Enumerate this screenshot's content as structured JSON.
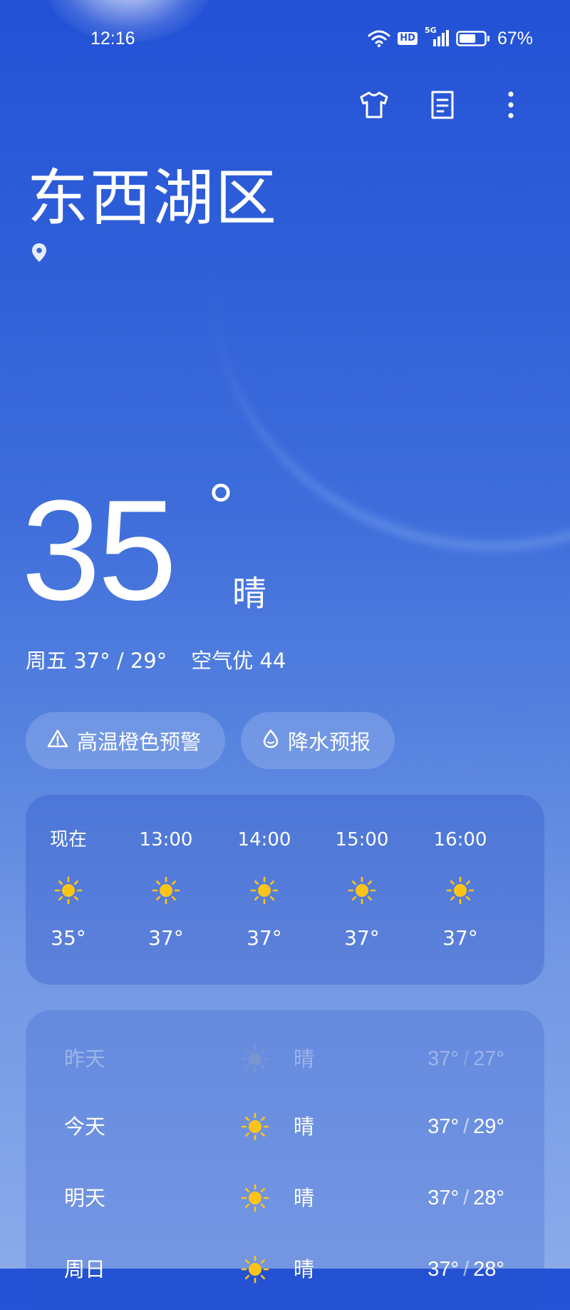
{
  "status_bar": {
    "time": "12:16",
    "network": "5G",
    "hd": "HD",
    "battery": "67%",
    "battery_level": 0.67,
    "icons": [
      "wifi-icon",
      "hd-icon",
      "signal-5g-icon",
      "battery-icon"
    ]
  },
  "top_actions": {
    "icons": [
      "tshirt-icon",
      "document-icon",
      "more-vertical-icon"
    ]
  },
  "location": {
    "city": "东西湖区",
    "pin_icon": "location-pin-icon"
  },
  "current": {
    "temperature": "35",
    "degree": "°",
    "condition": "晴",
    "summary": "周五 37° / 29°",
    "air_quality": "空气优 44"
  },
  "chips": [
    {
      "label": "高温橙色预警",
      "icon": "warning-triangle-icon"
    },
    {
      "label": "降水预报",
      "icon": "raindrop-icon"
    }
  ],
  "hourly": [
    {
      "time": "现在",
      "temp": "35°",
      "icon": "sun-icon"
    },
    {
      "time": "13:00",
      "temp": "37°",
      "icon": "sun-icon"
    },
    {
      "time": "14:00",
      "temp": "37°",
      "icon": "sun-icon"
    },
    {
      "time": "15:00",
      "temp": "37°",
      "icon": "sun-icon"
    },
    {
      "time": "16:00",
      "temp": "37°",
      "icon": "sun-icon"
    }
  ],
  "daily": [
    {
      "day": "昨天",
      "condition": "晴",
      "high": "37°",
      "low": "27°",
      "sep": "/",
      "icon": "sun-icon",
      "dimmed": true
    },
    {
      "day": "今天",
      "condition": "晴",
      "high": "37°",
      "low": "29°",
      "sep": "/",
      "icon": "sun-icon",
      "dimmed": false
    },
    {
      "day": "明天",
      "condition": "晴",
      "high": "37°",
      "low": "28°",
      "sep": "/",
      "icon": "sun-icon",
      "dimmed": false
    },
    {
      "day": "周日",
      "condition": "晴",
      "high": "37°",
      "low": "28°",
      "sep": "/",
      "icon": "sun-icon",
      "dimmed": false
    }
  ],
  "colors": {
    "sun": "#fcc419",
    "sun_dim": "#9aa4b8",
    "background_top": "#2351d6",
    "background_bottom": "#8aaaea"
  }
}
